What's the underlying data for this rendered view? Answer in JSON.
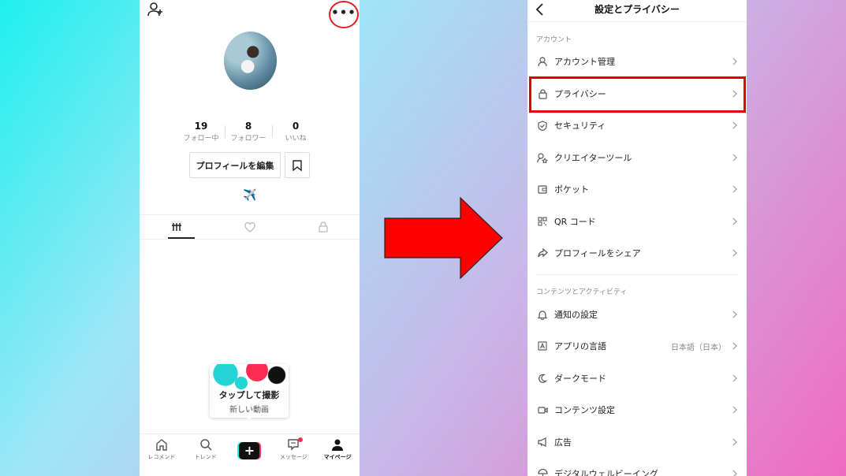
{
  "left_phone": {
    "stats": [
      {
        "value": "19",
        "label": "フォロー中"
      },
      {
        "value": "8",
        "label": "フォロワー"
      },
      {
        "value": "0",
        "label": "いいね"
      }
    ],
    "edit_profile_label": "プロフィールを編集",
    "bio_emoji": "✈️",
    "shoot_card": {
      "title": "タップして撮影",
      "subtitle": "新しい動画"
    },
    "nav": [
      {
        "label": "レコメンド",
        "icon": "home-icon"
      },
      {
        "label": "トレンド",
        "icon": "search-icon"
      },
      {
        "label": "",
        "icon": "create-plus-icon"
      },
      {
        "label": "メッセージ",
        "icon": "inbox-icon"
      },
      {
        "label": "マイページ",
        "icon": "profile-icon"
      }
    ],
    "more_icon": "•••"
  },
  "right_phone": {
    "title": "設定とプライバシー",
    "sections": [
      {
        "title": "アカウント",
        "items": [
          {
            "label": "アカウント管理",
            "icon": "person-icon"
          },
          {
            "label": "プライバシー",
            "icon": "lock-icon"
          },
          {
            "label": "セキュリティ",
            "icon": "shield-icon"
          },
          {
            "label": "クリエイターツール",
            "icon": "creator-icon"
          },
          {
            "label": "ポケット",
            "icon": "wallet-icon"
          },
          {
            "label": "QR コード",
            "icon": "qr-icon"
          },
          {
            "label": "プロフィールをシェア",
            "icon": "share-icon"
          }
        ]
      },
      {
        "title": "コンテンツとアクティビティ",
        "items": [
          {
            "label": "通知の設定",
            "icon": "bell-icon"
          },
          {
            "label": "アプリの言語",
            "icon": "language-icon",
            "value": "日本語（日本）"
          },
          {
            "label": "ダークモード",
            "icon": "moon-icon"
          },
          {
            "label": "コンテンツ設定",
            "icon": "video-icon"
          },
          {
            "label": "広告",
            "icon": "megaphone-icon"
          },
          {
            "label": "デジタルウェルビーイング",
            "icon": "umbrella-icon"
          }
        ]
      }
    ]
  },
  "colors": {
    "highlight": "#e20000",
    "tiktok_red": "#fe2c55",
    "tiktok_cyan": "#25f4ee"
  }
}
